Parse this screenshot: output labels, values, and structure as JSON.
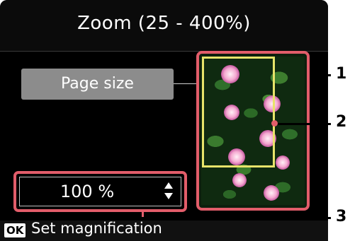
{
  "title": "Zoom (25 - 400%)",
  "page_size_button": "Page size",
  "magnification_value": "100 %",
  "footer": {
    "ok_label": "OK",
    "action_text": "Set magnification"
  },
  "callouts": {
    "one": "1",
    "two": "2",
    "three": "3"
  },
  "colors": {
    "highlight": "#e25d6a",
    "zoom_rect": "#e7e36a"
  }
}
